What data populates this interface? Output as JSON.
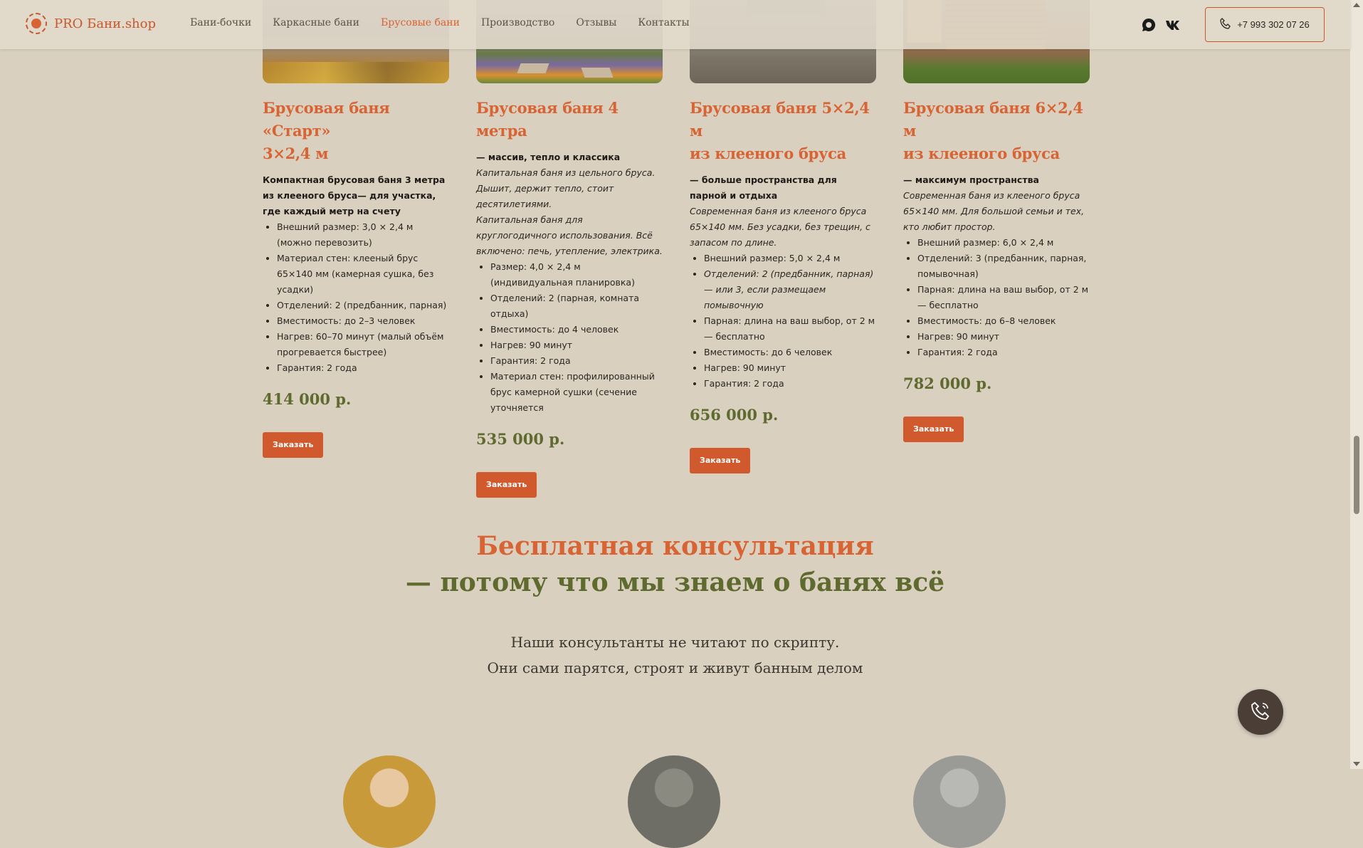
{
  "header": {
    "logo_text": "PRO Бани.shop",
    "nav": [
      {
        "label": "Бани-бочки"
      },
      {
        "label": "Каркасные бани"
      },
      {
        "label": "Брусовые бани"
      },
      {
        "label": "Производство"
      },
      {
        "label": "Отзывы"
      },
      {
        "label": "Контакты"
      }
    ],
    "active_nav": "Брусовые бани",
    "phone": "+7 993 302 07 26"
  },
  "cards": [
    {
      "title": "Брусовая баня «Старт»\n3×2,4 м",
      "lead": "Компактная брусовая баня 3 метра из клееного бруса— для участка, где каждый метр на счету",
      "desc": [],
      "features": [
        "Внешний размер: 3,0 × 2,4 м (можно перевозить)",
        "Материал стен: клееный брус 65×140 мм (камерная сушка, без усадки)",
        "Отделений: 2 (предбанник, парная)",
        "Вместимость: до 2–3 человек",
        "Нагрев: 60–70 минут (малый объём прогревается быстрее)",
        "Гарантия: 2 года"
      ],
      "price": "414 000 р.",
      "button": "Заказать"
    },
    {
      "title": "Брусовая баня 4\nметра",
      "lead": "— массив, тепло и классика",
      "desc": [
        "Капитальная баня из цельного бруса. Дышит, держит тепло, стоит десятилетиями.",
        "Капитальная баня для круглогодичного использования. Всё включено: печь, утепление, электрика."
      ],
      "features": [
        "Размер: 4,0 × 2,4 м (индивидуальная планировка)",
        "Отделений: 2 (парная, комната отдыха)",
        "Вместимость: до 4 человек",
        "Нагрев: 90 минут",
        "Гарантия: 2 года",
        "Материал стен: профилированный брус камерной сушки (сечение уточняется"
      ],
      "price": "535 000 р.",
      "button": "Заказать"
    },
    {
      "title": "Брусовая баня 5×2,4 м\nиз клееного бруса",
      "lead": "— больше пространства для парной и отдыха",
      "desc": [
        "Современная баня из клееного бруса 65×140 мм. Без усадки, без трещин, с запасом по длине."
      ],
      "features": [
        "Внешний размер: 5,0 × 2,4 м",
        "Отделений: 2 (предбанник, парная)— или 3, если размещаем помывочную",
        "Парная: длина на ваш выбор, от 2 м — бесплатно",
        "Вместимость: до 6 человек",
        "Нагрев: 90 минут",
        "Гарантия: 2 года"
      ],
      "price": "656 000 р.",
      "button": "Заказать"
    },
    {
      "title": "Брусовая баня 6×2,4 м\nиз клееного бруса",
      "lead": "— максимум пространства",
      "desc": [
        "Современная баня из клееного бруса 65×140 мм. Для большой семьи и тех, кто любит простор."
      ],
      "features": [
        "Внешний размер: 6,0 × 2,4 м",
        "Отделений: 3 (предбанник, парная, помывочная)",
        "Парная: длина на ваш выбор, от 2 м — бесплатно",
        "Вместимость: до 6–8 человек",
        "Нагрев: 90 минут",
        "Гарантия: 2 года"
      ],
      "price": "782 000 р.",
      "button": "Заказать"
    }
  ],
  "consultation": {
    "title": "Бесплатная консультация",
    "subtitle": "— потому что мы знаем о банях всё",
    "line1": "Наши консультанты не читают по скрипту.",
    "line2": "Они сами парятся, строят и живут банным делом"
  },
  "colors": {
    "accent": "#d86434",
    "price_green": "#5e6a2e",
    "background": "#d9d0c0",
    "button": "#d05a2e"
  },
  "icons": {
    "logo": "sauna-logo-icon",
    "whatsapp": "whatsapp-icon",
    "vk": "vk-icon",
    "phone": "phone-icon",
    "call_fab": "phone-call-icon"
  }
}
